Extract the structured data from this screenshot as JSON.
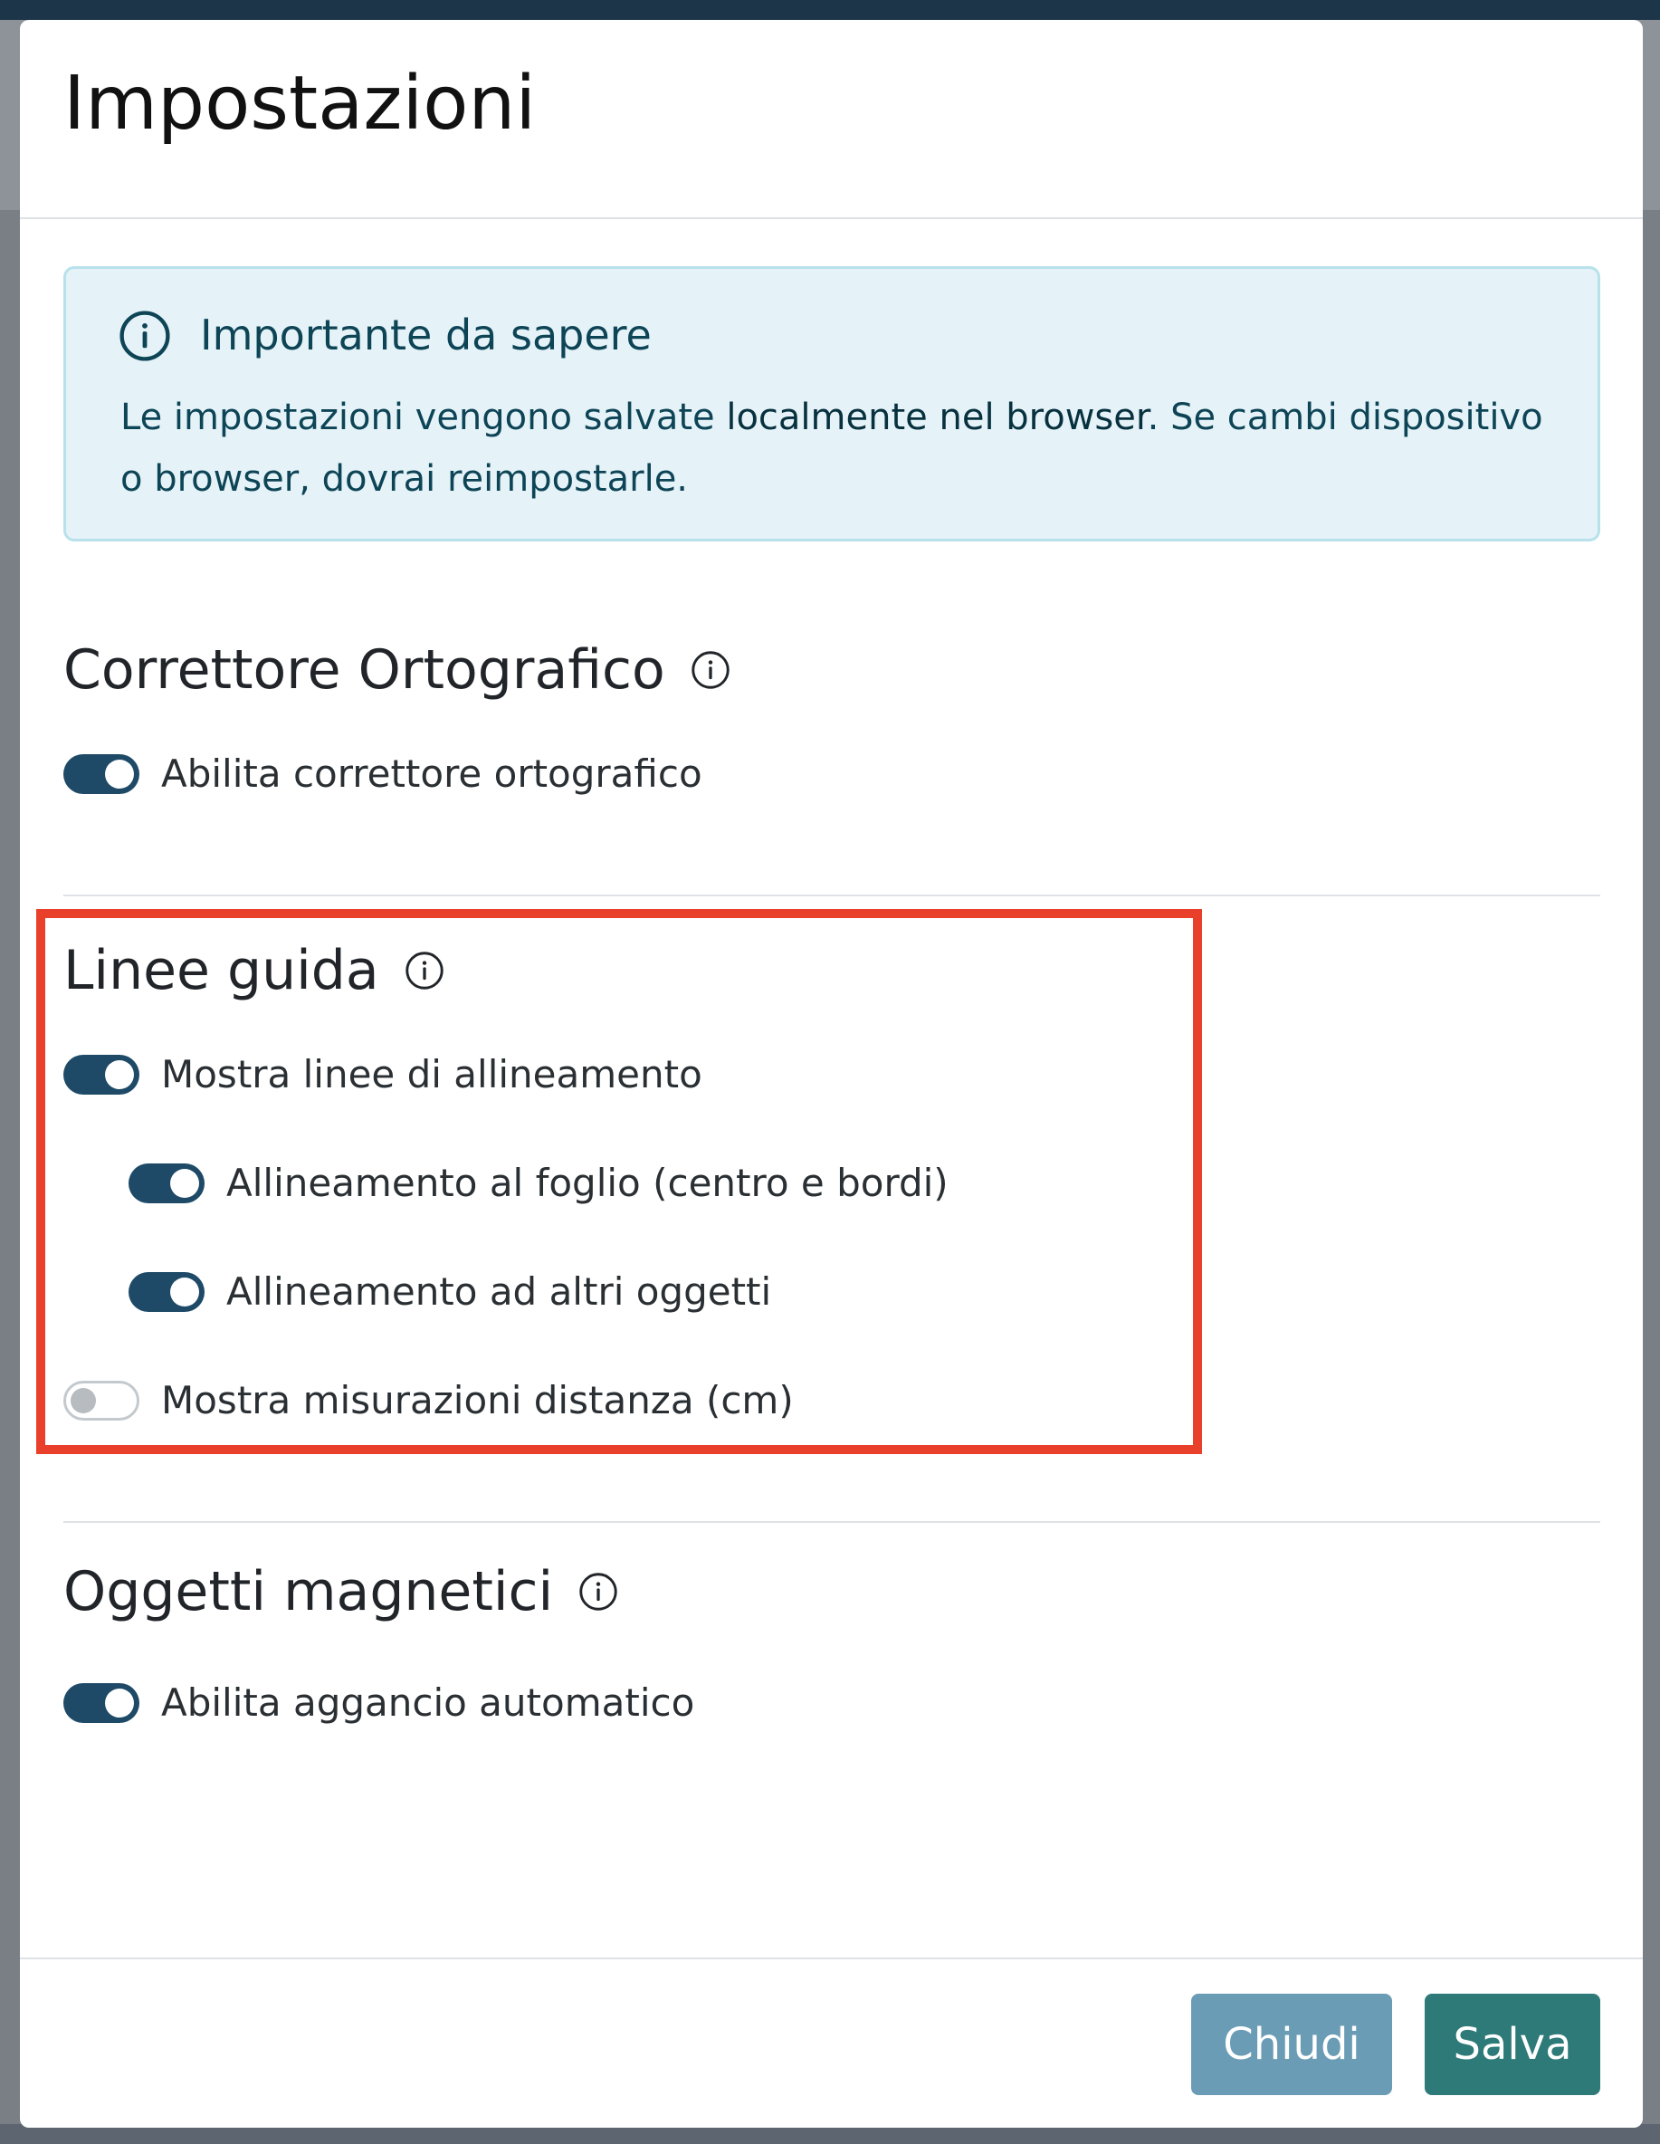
{
  "modal": {
    "title": "Impostazioni"
  },
  "alert": {
    "icon": "info-circle-icon",
    "title": "Importante da sapere",
    "text_before": "Le impostazioni vengono salvate ",
    "text_bold": "localmente nel browser",
    "text_after": ". Se cambi dispositivo o browser, dovrai reimpostarle."
  },
  "sections": {
    "spell": {
      "title": "Correttore Ortografico",
      "toggle_label": "Abilita correttore ortografico",
      "toggle_on": true
    },
    "guides": {
      "title": "Linee guida",
      "show_lines_label": "Mostra linee di allineamento",
      "show_lines_on": true,
      "sheet_align_label": "Allineamento al foglio (centro e bordi)",
      "sheet_align_on": true,
      "objects_align_label": "Allineamento ad altri oggetti",
      "objects_align_on": true,
      "distance_label": "Mostra misurazioni distanza (cm)",
      "distance_on": false
    },
    "magnetic": {
      "title": "Oggetti magnetici",
      "toggle_label": "Abilita aggancio automatico",
      "toggle_on": true
    }
  },
  "footer": {
    "close_label": "Chiudi",
    "save_label": "Salva"
  },
  "colors": {
    "toggle_on": "#1e4a67",
    "highlight": "#e8402a",
    "close_button": "#6a9cb5",
    "save_button": "#2d7a78",
    "alert_bg": "#e5f3f8"
  }
}
